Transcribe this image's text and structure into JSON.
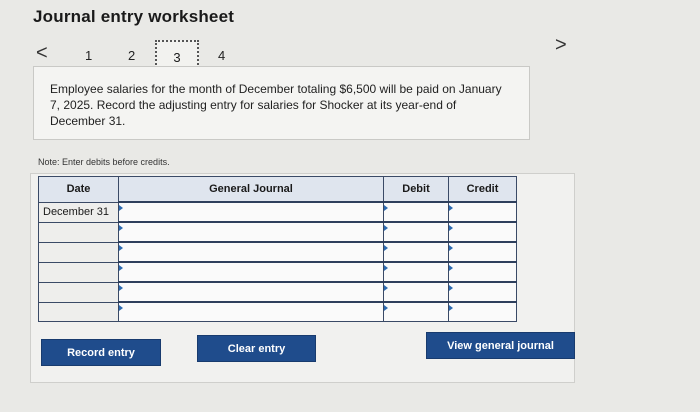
{
  "page": {
    "title": "Journal entry worksheet"
  },
  "pager": {
    "prev_glyph": "<",
    "next_glyph": ">",
    "pages": [
      "1",
      "2",
      "3",
      "4"
    ],
    "current": "3"
  },
  "prompt": {
    "text": "Employee salaries for the month of December totaling $6,500 will be paid on January 7, 2025. Record the adjusting entry for salaries for Shocker at its year-end of December 31."
  },
  "note": "Note: Enter debits before credits.",
  "journal": {
    "headers": {
      "date": "Date",
      "general_journal": "General Journal",
      "debit": "Debit",
      "credit": "Credit"
    },
    "rows": [
      {
        "date": "December 31",
        "account": "",
        "debit": "",
        "credit": ""
      },
      {
        "date": "",
        "account": "",
        "debit": "",
        "credit": ""
      },
      {
        "date": "",
        "account": "",
        "debit": "",
        "credit": ""
      },
      {
        "date": "",
        "account": "",
        "debit": "",
        "credit": ""
      },
      {
        "date": "",
        "account": "",
        "debit": "",
        "credit": ""
      },
      {
        "date": "",
        "account": "",
        "debit": "",
        "credit": ""
      }
    ]
  },
  "buttons": {
    "record": "Record entry",
    "clear": "Clear entry",
    "view": "View general journal"
  },
  "colors": {
    "button_bg": "#1f4c8c",
    "header_bg": "#dfe5ee",
    "grid": "#3a4a66"
  }
}
